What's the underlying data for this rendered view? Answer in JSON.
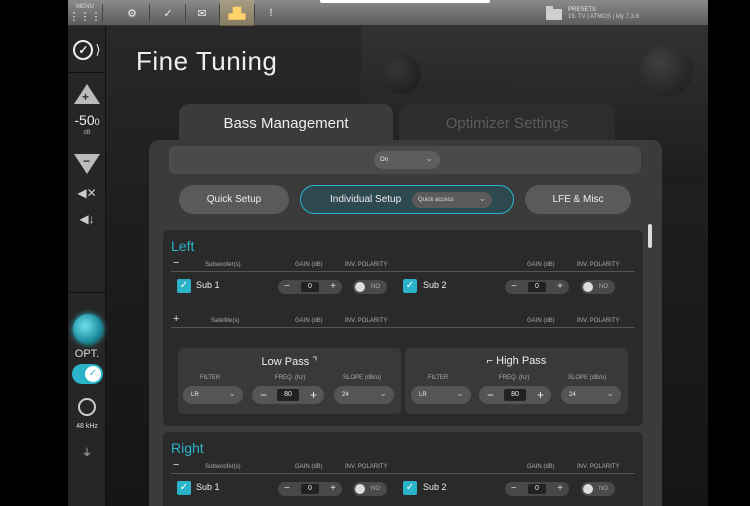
{
  "topbar": {
    "items": [
      {
        "icon": "grid-icon",
        "label": "MENU"
      },
      {
        "icon": "gears-icon",
        "label": ""
      },
      {
        "icon": "check-icon",
        "label": ""
      },
      {
        "icon": "envelope-icon",
        "label": ""
      },
      {
        "icon": "equalizer-icon",
        "label": ""
      },
      {
        "icon": "bottle-icon",
        "label": ""
      }
    ],
    "presets": {
      "label": "PRESETS",
      "value": "19. TV | ATMOS | My 7.3.6"
    }
  },
  "sidebar": {
    "volume": {
      "value": "-50",
      "decimal": "0",
      "unit": "dB"
    },
    "opt_label": "OPT.",
    "sample_rate": "48 kHz"
  },
  "page": {
    "title": "Fine Tuning",
    "tabs": [
      {
        "label": "Bass Management",
        "active": true
      },
      {
        "label": "Optimizer Settings",
        "active": false
      }
    ]
  },
  "bass": {
    "mode_value": "On",
    "buttons": {
      "quick": "Quick Setup",
      "individual": "Individual Setup",
      "quick_access": "Quick access",
      "lfe": "LFE & Misc"
    }
  },
  "headers": {
    "subwoofers": "Subwoofer(s)",
    "satellites": "Satellite(s)",
    "gain": "GAIN (dB)",
    "inv_polarity": "INV. POLARITY",
    "filter": "FILTER",
    "freq": "FREQ. (hz)",
    "slope": "SLOPE (dB/o)"
  },
  "channels": {
    "left": {
      "title": "Left",
      "subs": [
        {
          "name": "Sub 1",
          "gain": "0",
          "polarity": "NO"
        },
        {
          "name": "Sub 2",
          "gain": "0",
          "polarity": "NO"
        }
      ],
      "low_pass": {
        "title": "Low Pass",
        "filter": "LR",
        "freq": "80",
        "slope": "24"
      },
      "high_pass": {
        "title": "High Pass",
        "filter": "LR",
        "freq": "80",
        "slope": "24"
      }
    },
    "right": {
      "title": "Right",
      "subs": [
        {
          "name": "Sub 1",
          "gain": "0",
          "polarity": "NO"
        },
        {
          "name": "Sub 2",
          "gain": "0",
          "polarity": "NO"
        }
      ]
    }
  },
  "colors": {
    "accent": "#2bb3c9",
    "tab_active": "#3b3b3b",
    "card": "#2a2a2a"
  }
}
